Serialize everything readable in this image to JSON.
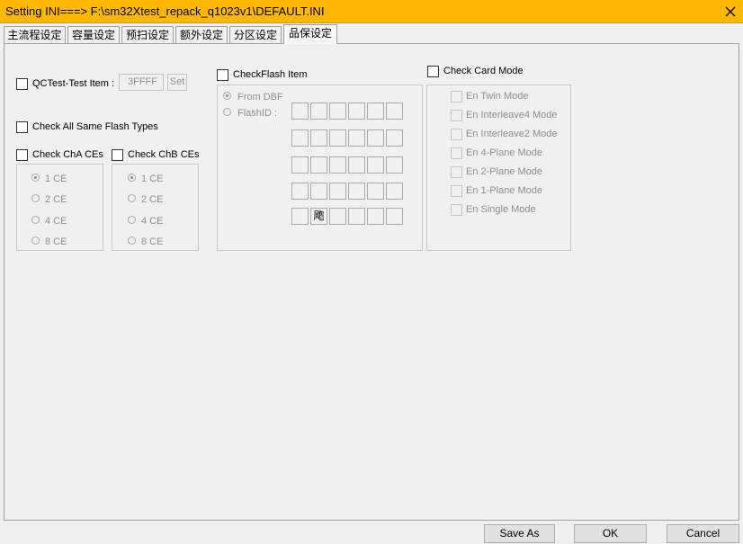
{
  "window": {
    "title": "Setting  INI===> F:\\sm32Xtest_repack_q1023v1\\DEFAULT.INI",
    "close_icon": "close-icon",
    "accent_color": "#ffb800"
  },
  "tabs": [
    {
      "label": "主流程设定",
      "active": false
    },
    {
      "label": "容量设定",
      "active": false
    },
    {
      "label": "预扫设定",
      "active": false
    },
    {
      "label": "额外设定",
      "active": false
    },
    {
      "label": "分区设定",
      "active": false
    },
    {
      "label": "品保设定",
      "active": true
    }
  ],
  "qctest": {
    "label": "QCTest-Test Item :",
    "value": "3FFFF",
    "set_label": "Set",
    "checked": false
  },
  "check_all_same": {
    "label": "Check All Same Flash Types",
    "checked": false
  },
  "cha": {
    "label": "Check ChA CEs",
    "checked": false,
    "options": [
      "1 CE",
      "2 CE",
      "4 CE",
      "8 CE"
    ],
    "selected": "1 CE"
  },
  "chb": {
    "label": "Check ChB CEs",
    "checked": false,
    "options": [
      "1 CE",
      "2 CE",
      "4 CE",
      "8 CE"
    ],
    "selected": "1 CE"
  },
  "checkflash": {
    "label": "CheckFlash Item",
    "checked": false,
    "from_dbf": "From DBF",
    "flash_id": "FlashID :",
    "grid_cells": [
      [
        "",
        "",
        "",
        "",
        "",
        ""
      ],
      [
        "",
        "",
        "",
        "",
        "",
        ""
      ],
      [
        "",
        "",
        "",
        "",
        "",
        ""
      ],
      [
        "",
        "",
        "",
        "",
        "",
        ""
      ],
      [
        "",
        "飑",
        "",
        "",
        "",
        ""
      ]
    ]
  },
  "cardmode": {
    "label": "Check Card Mode",
    "checked": false,
    "options": [
      "En Twin Mode",
      "En Interleave4 Mode",
      "En Interleave2 Mode",
      "En 4-Plane Mode",
      "En 2-Plane Mode",
      "En 1-Plane Mode",
      "En Single Mode"
    ]
  },
  "buttons": {
    "save_as": "Save  As",
    "ok": "OK",
    "cancel": "Cancel"
  }
}
